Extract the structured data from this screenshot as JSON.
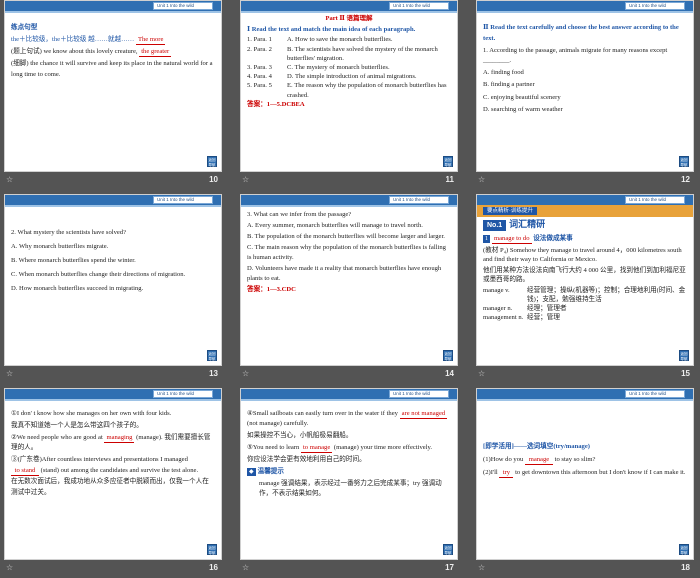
{
  "unit_label": "Unit 1  Into the wild",
  "nav_button_label": "返回\n导航",
  "slides": [
    {
      "num": "10",
      "heading": "练点句型",
      "line1_a": "the＋比较级，the＋比较级",
      "line1_b": "越……就越……",
      "blank1": "The more",
      "line2_a": "(题上句试)",
      "line2_b": "we know about this lovely creature,",
      "blank2": "the greater",
      "line3": "(细脚) the chance it will survive and keep its place in the natural world for a long time to come."
    },
    {
      "num": "11",
      "part_title": "Part Ⅱ  语篇理解",
      "instruction": "Ⅰ  Read the text and match the main idea of each paragraph.",
      "rows": [
        {
          "para": "1. Para. 1",
          "idea": "A. How to save the monarch butterflies."
        },
        {
          "para": "2. Para. 2",
          "idea": "B. The scientists have solved the mystery of the monarch butterflies' migration."
        },
        {
          "para": "3. Para. 3",
          "idea": "C. The mystery of monarch butterflies."
        },
        {
          "para": "4. Para. 4",
          "idea": "D. The simple introduction of animal migrations."
        },
        {
          "para": "5. Para. 5",
          "idea": "E. The reason why the population of monarch butterflies has crashed."
        }
      ],
      "answer": "答案：1—5.DCBEA"
    },
    {
      "num": "12",
      "instruction": "Ⅱ  Read the text carefully and choose the best answer according to the text.",
      "question": "1. According to the passage, animals migrate for many reasons except ________.",
      "options": [
        "A. finding food",
        "B. finding a partner",
        "C. enjoying beautiful scenery",
        "D. searching of warm weather"
      ]
    },
    {
      "num": "13",
      "question": "2. What mystery the scientists have solved?",
      "options": [
        "A. Why monarch butterflies migrate.",
        "B. Where monarch butterflies spend the winter.",
        "C. When monarch butterflies change their directions of migration.",
        "D. How monarch butterflies succeed in migrating."
      ]
    },
    {
      "num": "14",
      "question": "3. What can we infer from the passage?",
      "options": [
        "A. Every summer, monarch butterflies will manage to travel north.",
        "B. The population of the monarch butterflies will become larger and larger.",
        "C. The main reason why the population of the monarch butterflies is falling is human activity.",
        "D. Volunteers have made it a reality that monarch butterflies have enough plants to eat."
      ],
      "answer": "答案：1—3.CDC"
    },
    {
      "num": "15",
      "bar_label": "要点精析·训练提升",
      "no_label": "No.1",
      "big_title": "词汇精研",
      "item_num": "1",
      "item_word": "manage to do",
      "item_cn": "设法做成某事",
      "example": "(教材 P₄) Somehow they manage to travel around 4，000 kilometres south and find their way to California or Mexico.",
      "example_blank": "manage to travel",
      "example_cn": "他们用某种方法设法向南飞行大约 4 000 公里，找到他们到加利福尼亚或墨西哥的路。",
      "defs": [
        {
          "w": "manage v.",
          "d": "经营管理；操纵(机器等)；控制；合理地利用(时间、金钱)；支配，勉强维持生活"
        },
        {
          "w": "manager n.",
          "d": "经理；管理者"
        },
        {
          "w": "management n.",
          "d": "经营；管理"
        }
      ]
    },
    {
      "num": "16",
      "s1": "①I don' t know how she manages on her own with four kids.",
      "s1_cn": "我真不知道她一个人是怎么带这四个孩子的。",
      "s2_a": "②We need people who are good at",
      "s2_blank": "managing",
      "s2_b": "(manage).  我们需要擅长管理的人。",
      "s3_a": "③(广东卷)After countless interviews and presentations I managed",
      "s3_blank": "to stand",
      "s3_b": "(stand) out among the candidates and survive the test alone.",
      "s3_cn": "在无数次面试后，我成功地从众多应征者中脱颖而出，仅我一个人在测试中过关。"
    },
    {
      "num": "17",
      "s4_a": "④Small sailboats can easily turn over in the water if they",
      "s4_blank": "are not managed",
      "s4_b": "(not manage) carefully.",
      "s4_cn": "如果操控不当心，小帆船极易翻船。",
      "s5_a": "⑤You need to learn",
      "s5_blank": "to manage",
      "s5_b": "(manage) your time more effectively.",
      "s5_cn": "你应设法学会更有效地利用自己的时间。",
      "tip_label": "温馨提示",
      "tip": "manage 强调结果，表示经过一番努力之后完成某事；try 强调动作，不表示结果如何。"
    },
    {
      "num": "18",
      "title": "[即学活用]——选词填空(try/manage)",
      "q1_a": "(1)How do you",
      "q1_blank": "manage",
      "q1_b": "to stay so slim?",
      "q2_a": "(2)I'll",
      "q2_blank": "try",
      "q2_b": "to get downtown this afternoon but I don't know if I can make it."
    }
  ]
}
